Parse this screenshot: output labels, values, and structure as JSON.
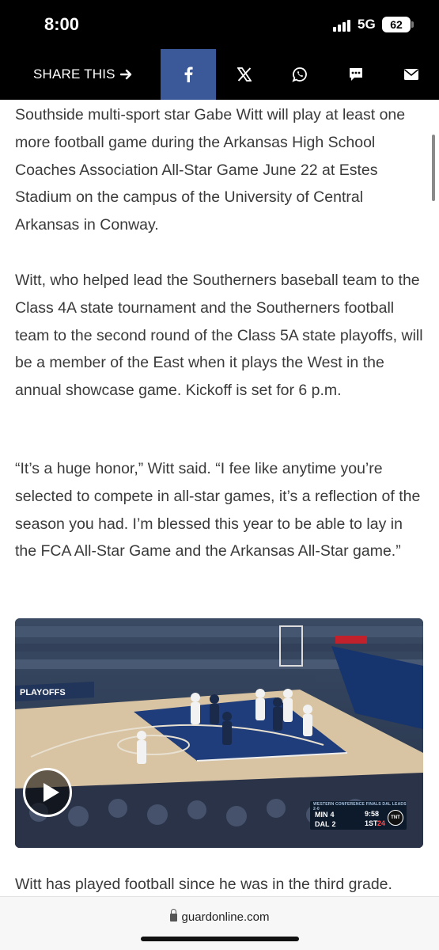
{
  "status_bar": {
    "time": "8:00",
    "network": "5G",
    "battery": "62"
  },
  "share_bar": {
    "label": "SHARE THIS",
    "buttons": [
      "facebook-icon",
      "x-icon",
      "whatsapp-icon",
      "sms-icon",
      "mail-icon"
    ],
    "colors": {
      "bar": "#000000",
      "facebook": "#3b5998"
    }
  },
  "article": {
    "paragraphs": [
      "Southside multi-sport star Gabe Witt will play at least one more football game during the Arkansas High School Coaches Association All-Star Game June 22 at Estes Stadium on the campus of the University of Central Arkansas in Conway.",
      "Witt, who helped lead the Southerners baseball team to the Class 4A state tournament and the Southerners football team to the second round of the Class 5A state playoffs, will be a member of the East when it plays the West in the annual showcase game. Kickoff is set for 6 p.m.",
      "“It’s a huge honor,” Witt said. “I fee like anytime you’re selected to compete in all-star games, it’s a reflection of the season you had. I’m blessed this year to be able to lay in the FCA All-Star Game and the Arkansas All-Star game.”",
      "Witt has played football since he was in the third grade."
    ]
  },
  "video": {
    "scorebug": {
      "header": "WESTERN CONFERENCE FINALS  DAL LEADS 2-0",
      "team1": "MIN",
      "score1": "4",
      "team2": "DAL",
      "score2": "2",
      "clock": "9:58",
      "period": "1ST",
      "shot_clock": "24",
      "network": "TNT"
    },
    "banner": "PLAYOFFS"
  },
  "browser": {
    "url": "guardonline.com"
  }
}
